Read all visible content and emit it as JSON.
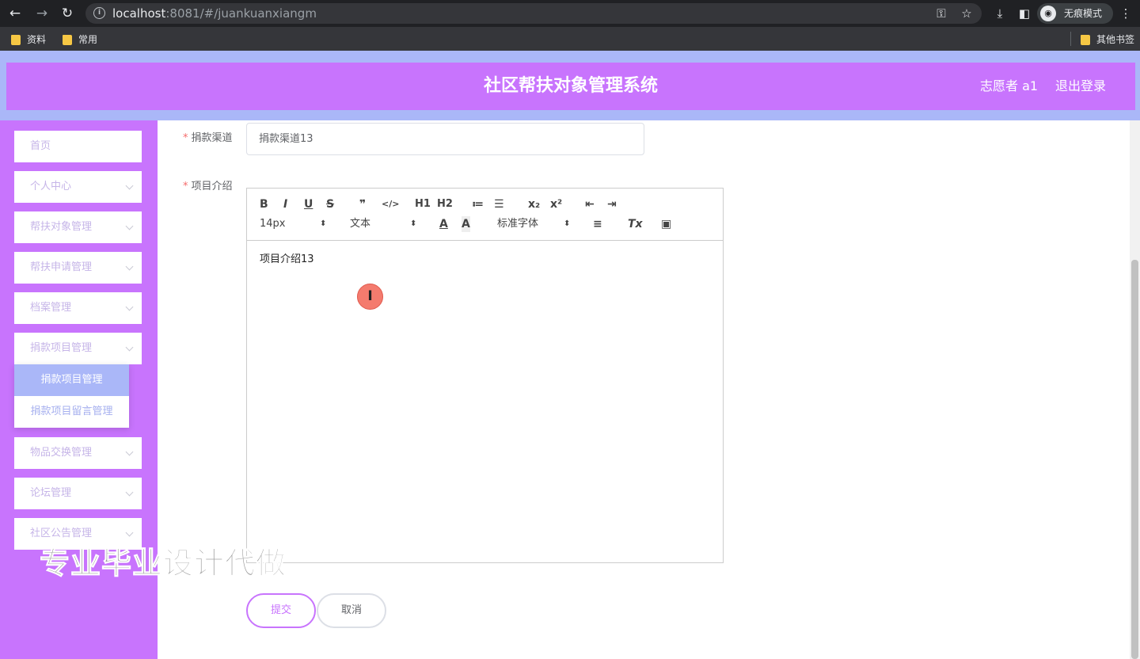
{
  "browser": {
    "url_host": "localhost",
    "url_path": ":8081/#/juankuanxiangm",
    "incognito_label": "无痕模式",
    "bookmarks": [
      "资料",
      "常用"
    ],
    "other_bookmarks": "其他书签"
  },
  "header": {
    "title": "社区帮扶对象管理系统",
    "user": "志愿者 a1",
    "logout": "退出登录"
  },
  "sidebar": {
    "items": [
      {
        "label": "首页"
      },
      {
        "label": "个人中心"
      },
      {
        "label": "帮扶对象管理"
      },
      {
        "label": "帮扶申请管理"
      },
      {
        "label": "档案管理"
      },
      {
        "label": "捐款项目管理"
      },
      {
        "label": "物品交换管理"
      },
      {
        "label": "论坛管理"
      },
      {
        "label": "社区公告管理"
      }
    ],
    "submenu": [
      {
        "label": "捐款项目管理"
      },
      {
        "label": "捐款项目留言管理"
      }
    ]
  },
  "form": {
    "channel_label": "捐款渠道",
    "channel_value": "捐款渠道13",
    "intro_label": "项目介绍",
    "intro_value": "项目介绍13",
    "submit": "提交",
    "cancel": "取消"
  },
  "editor_toolbar": {
    "bold": "B",
    "italic": "I",
    "underline": "U",
    "strike": "S",
    "quote": "❞",
    "code": "</>",
    "h1": "H1",
    "h2": "H2",
    "ordered": "≔",
    "bullet": "☰",
    "sub": "x₂",
    "sup": "x²",
    "outdent": "⇤",
    "indent": "⇥",
    "size": "14px",
    "header": "文本",
    "font": "标准字体",
    "color": "A",
    "bg": "A",
    "align": "≡",
    "clean": "Tx",
    "image": "▣"
  },
  "watermark": "专业毕业设计代做",
  "colors": {
    "accent": "#c874fd",
    "lavender": "#aab7f8"
  }
}
